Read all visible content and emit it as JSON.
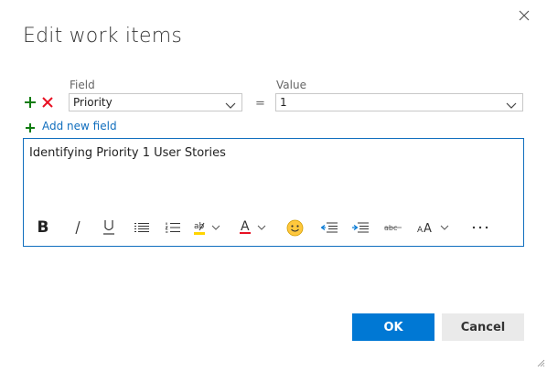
{
  "dialog": {
    "title": "Edit work items",
    "close_icon": "close-icon"
  },
  "field_row": {
    "field_label": "Field",
    "value_label": "Value",
    "field_value": "Priority",
    "equals": "=",
    "value_value": "1"
  },
  "add_field_label": "Add new field",
  "editor": {
    "text": "Identifying Priority 1 User Stories",
    "toolbar": [
      "bold-icon",
      "italic-icon",
      "underline-icon",
      "bulleted-list-icon",
      "numbered-list-icon",
      "highlight-icon",
      "font-color-icon",
      "emoji-icon",
      "decrease-indent-icon",
      "increase-indent-icon",
      "strikethrough-icon",
      "font-size-icon",
      "more-icon"
    ]
  },
  "buttons": {
    "ok": "OK",
    "cancel": "Cancel"
  },
  "colors": {
    "accent": "#0078d4",
    "add_green": "#107c10",
    "remove_red": "#e81123"
  }
}
